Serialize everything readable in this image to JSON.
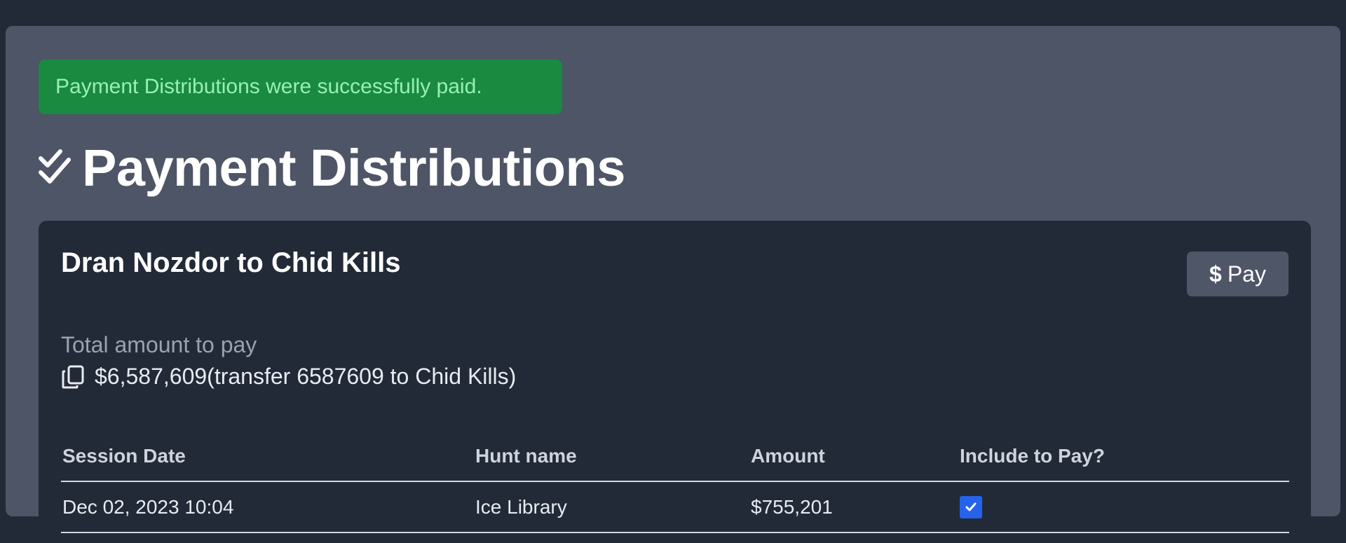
{
  "alert": {
    "message": "Payment Distributions were successfully paid."
  },
  "page": {
    "title": "Payment Distributions",
    "title_icon": "double-check-icon"
  },
  "distribution": {
    "title": "Dran Nozdor to Chid Kills",
    "pay_button": {
      "icon": "dollar-icon",
      "label": "Pay"
    },
    "total_label": "Total amount to pay",
    "total_amount": "$6,587,609",
    "transfer_text": "(transfer 6587609 to Chid Kills)",
    "copy_icon": "copy-icon",
    "table": {
      "headers": [
        "Session Date",
        "Hunt name",
        "Amount",
        "Include to Pay?"
      ],
      "rows": [
        {
          "session_date": "Dec 02, 2023 10:04",
          "hunt_name": "Ice Library",
          "amount": "$755,201",
          "include": true
        }
      ]
    }
  },
  "colors": {
    "background": "#222a38",
    "panel": "#4d5567",
    "success": "#1a8a41",
    "success_text": "#98f0b4",
    "checkbox": "#2563eb"
  }
}
